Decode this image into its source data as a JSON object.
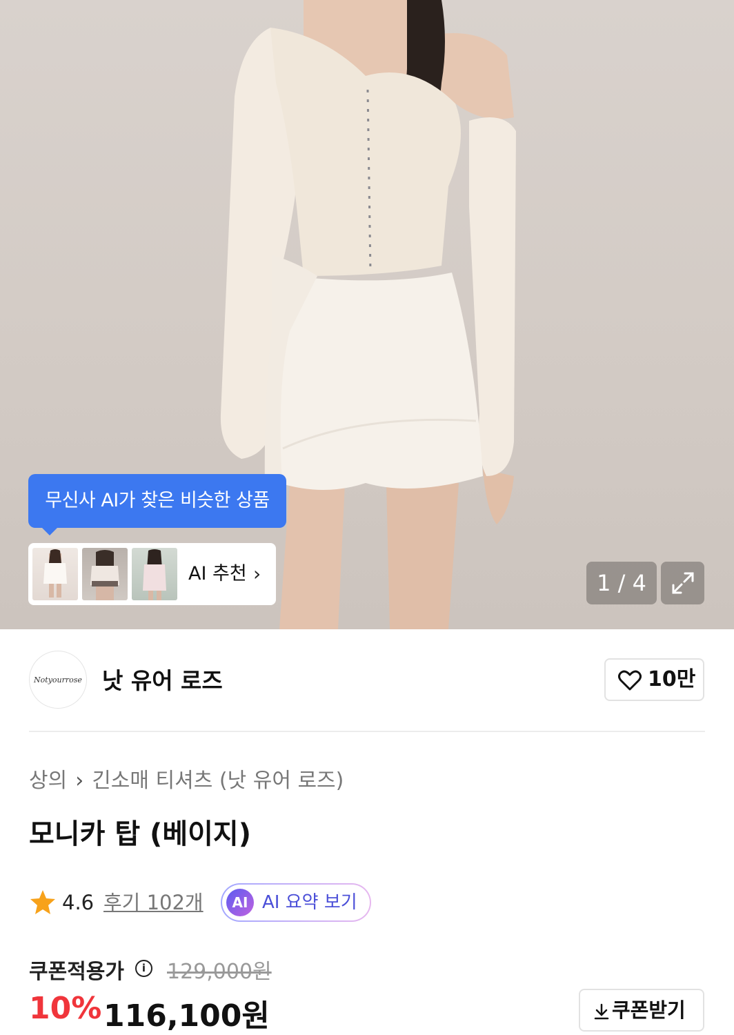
{
  "hero": {
    "ai_bubble_text": "무신사 AI가 찾은 비슷한 상품",
    "ai_recommend_label": "AI 추천",
    "page_indicator": "1 / 4"
  },
  "brand": {
    "logo_text": "Notyourrose",
    "name": "낫 유어 로즈",
    "like_count": "10만"
  },
  "product": {
    "breadcrumb": [
      "상의",
      "긴소매 티셔츠 (낫 유어 로즈)"
    ],
    "title": "모니카 탑 (베이지)",
    "rating": "4.6",
    "reviews": "후기 102개",
    "ai_badge": "AI",
    "ai_summary_label": "AI 요약 보기"
  },
  "price": {
    "coupon_label": "쿠폰적용가",
    "original": "129,000원",
    "discount": "10%",
    "final": "116,100원",
    "coupon_button": "쿠폰받기"
  },
  "colors": {
    "accent_blue": "#3c78f0",
    "discount_red": "#f0353b",
    "star": "#f7a21b"
  }
}
